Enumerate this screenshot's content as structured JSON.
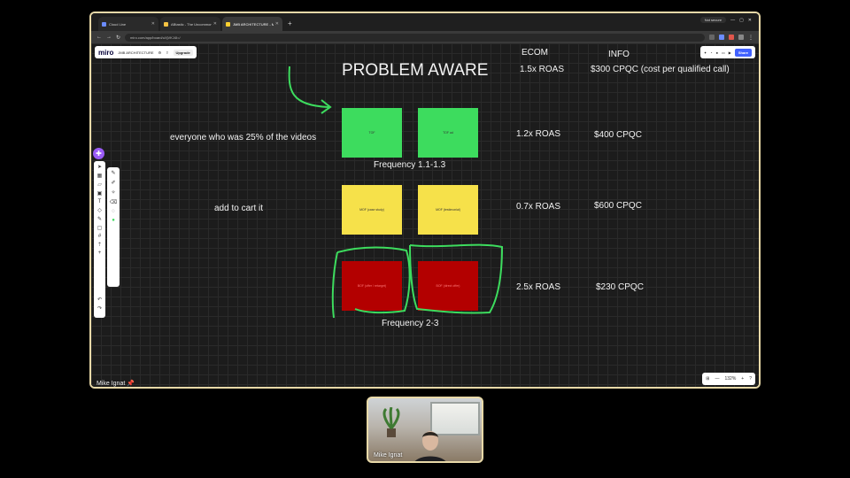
{
  "browser": {
    "tabs": [
      {
        "label": "Cloud Line",
        "color": "#6b8cff"
      },
      {
        "label": "ABtastic - The Uncommon Adve...",
        "color": "#f6c343"
      },
      {
        "label": "JMB ARCHITECTURE - Miro",
        "color": "#ffd02f"
      }
    ],
    "new_tab": "+",
    "not_secure": "Not secure",
    "url": "miro.com/app/board/uXjVKJ4I=/"
  },
  "miro": {
    "logo": "miro",
    "board_name": "JMB ARCHITECTURE",
    "upgrade": "Upgrade",
    "share": "Share",
    "zoom_level": "132%",
    "zoom_minus": "—",
    "zoom_plus": "+",
    "help": "?"
  },
  "board": {
    "title": "PROBLEM AWARE",
    "col_ecom": "ECOM",
    "col_info": "INFO",
    "row1": {
      "ecom": "1.5x ROAS",
      "info": "$300 CPQC (cost per qualified call)"
    },
    "row2": {
      "ecom": "1.2x ROAS",
      "info": "$400 CPQC",
      "note": "everyone who was 25% of the videos"
    },
    "freq1": "Frequency 1.1-1.3",
    "row3": {
      "ecom": "0.7x ROAS",
      "info": "$600 CPQC",
      "note": "add to cart it"
    },
    "row4": {
      "ecom": "2.5x ROAS",
      "info": "$230 CPQC"
    },
    "freq2": "Frequency 2-3",
    "stickies": {
      "g1": "TOF",
      "g2": "TOF ad",
      "y1": "MOF (case study)",
      "y2": "MOF (testimonial)",
      "r1": "BOF (offer / retarget)",
      "r2": "BOF (direct offer)"
    }
  },
  "presenter_tag": "Mike Ignat",
  "video": {
    "name": "Mike Ignat"
  }
}
